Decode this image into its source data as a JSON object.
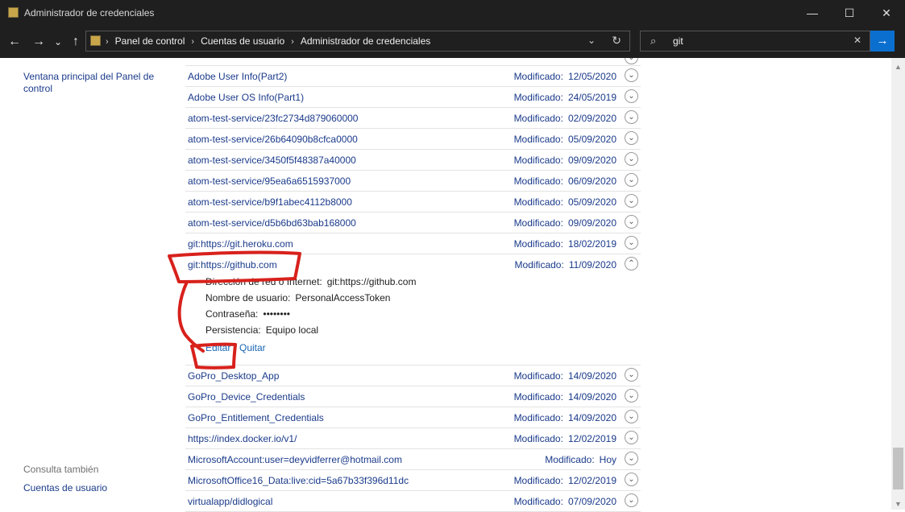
{
  "window": {
    "title": "Administrador de credenciales",
    "minimize": "—",
    "maximize": "☐",
    "close": "✕"
  },
  "nav": {
    "back": "←",
    "forward": "→",
    "recent": "⌄",
    "up": "↑"
  },
  "address": {
    "crumbs": [
      "Panel de control",
      "Cuentas de usuario",
      "Administrador de credenciales"
    ],
    "separator": "›",
    "dropdown": "⌄",
    "refresh": "↻"
  },
  "search": {
    "query": "git",
    "search_glyph": "⌕",
    "clear_glyph": "✕",
    "go_glyph": "→"
  },
  "left": {
    "home_link": "Ventana principal del Panel de control",
    "see_also": "Consulta también",
    "users_link": "Cuentas de usuario"
  },
  "modified_label": "Modificado:",
  "credentials": [
    {
      "name": "Adobe User Info(Part2)",
      "date": "12/05/2020"
    },
    {
      "name": "Adobe User OS Info(Part1)",
      "date": "24/05/2019"
    },
    {
      "name": "atom-test-service/23fc2734d879060000",
      "date": "02/09/2020"
    },
    {
      "name": "atom-test-service/26b64090b8cfca0000",
      "date": "05/09/2020"
    },
    {
      "name": "atom-test-service/3450f5f48387a40000",
      "date": "09/09/2020"
    },
    {
      "name": "atom-test-service/95ea6a6515937000",
      "date": "06/09/2020"
    },
    {
      "name": "atom-test-service/b9f1abec4112b8000",
      "date": "05/09/2020"
    },
    {
      "name": "atom-test-service/d5b6bd63bab168000",
      "date": "09/09/2020"
    },
    {
      "name": "git:https://git.heroku.com",
      "date": "18/02/2019"
    },
    {
      "name": "git:https://github.com",
      "date": "11/09/2020"
    },
    {
      "name": "GoPro_Desktop_App",
      "date": "14/09/2020"
    },
    {
      "name": "GoPro_Device_Credentials",
      "date": "14/09/2020"
    },
    {
      "name": "GoPro_Entitlement_Credentials",
      "date": "14/09/2020"
    },
    {
      "name": "https://index.docker.io/v1/",
      "date": "12/02/2019"
    },
    {
      "name": "MicrosoftAccount:user=deyvidferrer@hotmail.com",
      "date": "Hoy"
    },
    {
      "name": "MicrosoftOffice16_Data:live:cid=5a67b33f396d11dc",
      "date": "12/02/2019"
    },
    {
      "name": "virtualapp/didlogical",
      "date": "07/09/2020"
    }
  ],
  "expanded": {
    "address_label": "Dirección de red o Internet:",
    "address_value": "git:https://github.com",
    "user_label": "Nombre de usuario:",
    "user_value": "PersonalAccessToken",
    "password_label": "Contraseña:",
    "password_value": "••••••••",
    "persistence_label": "Persistencia:",
    "persistence_value": "Equipo local",
    "edit": "Editar",
    "remove": "Quitar"
  },
  "chevrons": {
    "down": "⌄",
    "up": "⌃"
  },
  "colors": {
    "link": "#1a3a8a",
    "action_link": "#1a66b4",
    "annotation": "#d8211c",
    "accent": "#0b6fd0"
  }
}
